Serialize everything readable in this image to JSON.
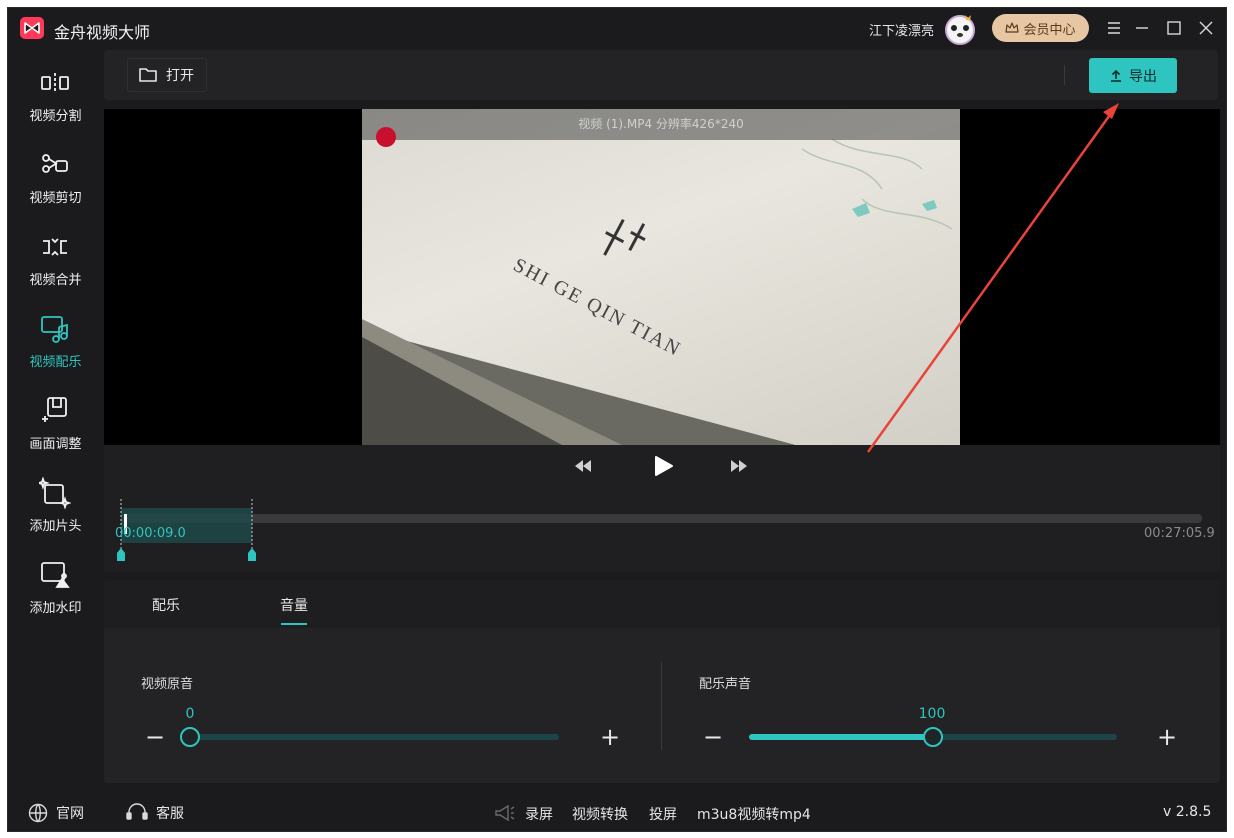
{
  "app": {
    "title": "金舟视频大师",
    "username": "江下凌漂亮",
    "vip_label": "会员中心",
    "accent_color": "#2ec5c0",
    "version": "v 2.8.5"
  },
  "sidebar": {
    "items": [
      {
        "label": "视频分割",
        "icon": "split-icon",
        "active": false
      },
      {
        "label": "视频剪切",
        "icon": "scissors-icon",
        "active": false
      },
      {
        "label": "视频合并",
        "icon": "merge-icon",
        "active": false
      },
      {
        "label": "视频配乐",
        "icon": "music-icon",
        "active": true
      },
      {
        "label": "画面调整",
        "icon": "crop-icon",
        "active": false
      },
      {
        "label": "添加片头",
        "icon": "add-intro-icon",
        "active": false
      },
      {
        "label": "添加水印",
        "icon": "watermark-icon",
        "active": false
      }
    ]
  },
  "toolbar": {
    "open_label": "打开",
    "export_label": "导出"
  },
  "preview": {
    "info": "视频 (1).MP4 分辨率426*240"
  },
  "timeline": {
    "current_time": "00:00:09.0",
    "total_time": "00:27:05.9"
  },
  "panel": {
    "tabs": [
      {
        "label": "配乐",
        "active": false
      },
      {
        "label": "音量",
        "active": true
      }
    ],
    "original_audio": {
      "label": "视频原音",
      "value": "0",
      "level": 0
    },
    "music_audio": {
      "label": "配乐声音",
      "value": "100",
      "level": 0.5
    }
  },
  "footer": {
    "website": "官网",
    "support": "客服",
    "record": "录屏",
    "convert": "视频转换",
    "cast": "投屏",
    "m3u8": "m3u8视频转mp4"
  }
}
